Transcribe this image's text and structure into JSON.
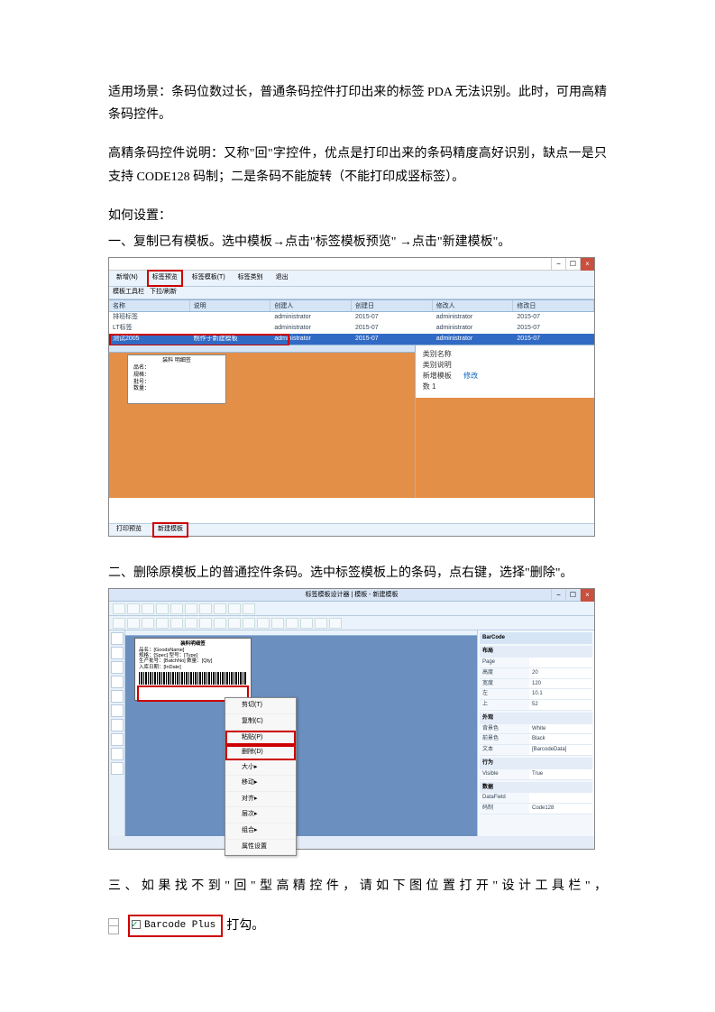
{
  "intro": {
    "p1": "适用场景：条码位数过长，普通条码控件打印出来的标签 PDA 无法识别。此时，可用高精条码控件。",
    "p2": "高精条码控件说明：又称\"回\"字控件，优点是打印出来的条码精度高好识别，缺点一是只支持 CODE128 码制；二是条码不能旋转（不能打印成竖标签）。",
    "howto": "如何设置：",
    "step1": "一、复制已有模板。选中模板→点击\"标签模板预览\" →点击\"新建模板\"。",
    "step2": "二、删除原模板上的普通控件条码。选中标签模板上的条码，点右键，选择\"删除\"。",
    "step3a": "三、如果找不到\"回\"型高精控件，请如下图位置打开\"设计工具栏\"，",
    "step3b": "打勾。"
  },
  "shot1": {
    "toolbar": {
      "btn1": "新增(N)",
      "btn2": "标签预览",
      "btn3": "标签模板(T)",
      "btn4": "标签类别",
      "btn5": "退出"
    },
    "subbar": {
      "a": "模板工具栏",
      "b": "下拉/刷新"
    },
    "cols": {
      "c1": "名称",
      "c2": "说明",
      "c3": "创建人",
      "c4": "创建日",
      "c5": "修改人",
      "c6": "修改日"
    },
    "rows": [
      {
        "c1": "排班标签",
        "c2": "",
        "c3": "administrator",
        "c4": "2015-07",
        "c5": "administrator",
        "c6": "2015-07"
      },
      {
        "c1": "LT标签",
        "c2": "",
        "c3": "administrator",
        "c4": "2015-07",
        "c5": "administrator",
        "c6": "2015-07"
      },
      {
        "c1": "测试2005",
        "c2": "制作于新建模板",
        "c3": "administrator",
        "c4": "2015-07",
        "c5": "administrator",
        "c6": "2015-07"
      }
    ],
    "preview": {
      "title": "装料 明细签",
      "l1": "品名：",
      "l2": "规格：",
      "l3": "批号：",
      "l4": "数量："
    },
    "right": {
      "l1": "类别名称",
      "l2": "类别说明",
      "l3": "新增模板",
      "l4": "数     1",
      "link": "修改"
    },
    "footer": {
      "b1": "打印预览",
      "b2": "新建模板"
    }
  },
  "shot2": {
    "title": "标签模板设计器 | 模板 - 新建模板",
    "label": {
      "title": "装料明细签",
      "l1": "品名：[GoodsName]",
      "l2": "规格：[Spec]     型号：[Type]",
      "l3": "生产批号：[BatchNo]   数量：[Qty]",
      "l4": "入库日期：[InDate]"
    },
    "context": {
      "i1": "剪切(T)",
      "i2": "复制(C)",
      "i3": "粘贴(P)",
      "i4": "删除(D)",
      "i5": "大小",
      "i6": "移动",
      "i7": "对齐",
      "i8": "层次",
      "i9": "组合",
      "i10": "属性设置"
    },
    "props": {
      "hdr": "BarCode",
      "cat1": "布局",
      "r1k": "Page",
      "r1v": "",
      "r2k": "高度",
      "r2v": "20",
      "r3k": "宽度",
      "r3v": "120",
      "r4k": "左",
      "r4v": "10.1",
      "r5k": "上",
      "r5v": "52",
      "cat2": "外观",
      "r6k": "背景色",
      "r6v": "White",
      "r7k": "前景色",
      "r7v": "Black",
      "r8k": "文本",
      "r8v": "[BarcodeData]",
      "cat3": "行为",
      "r9k": "Visible",
      "r9v": "True",
      "cat4": "数据",
      "r10k": "DataField",
      "r10v": "",
      "r11k": "码制",
      "r11v": "Code128"
    }
  },
  "checkbox": {
    "label": "Barcode Plus"
  }
}
